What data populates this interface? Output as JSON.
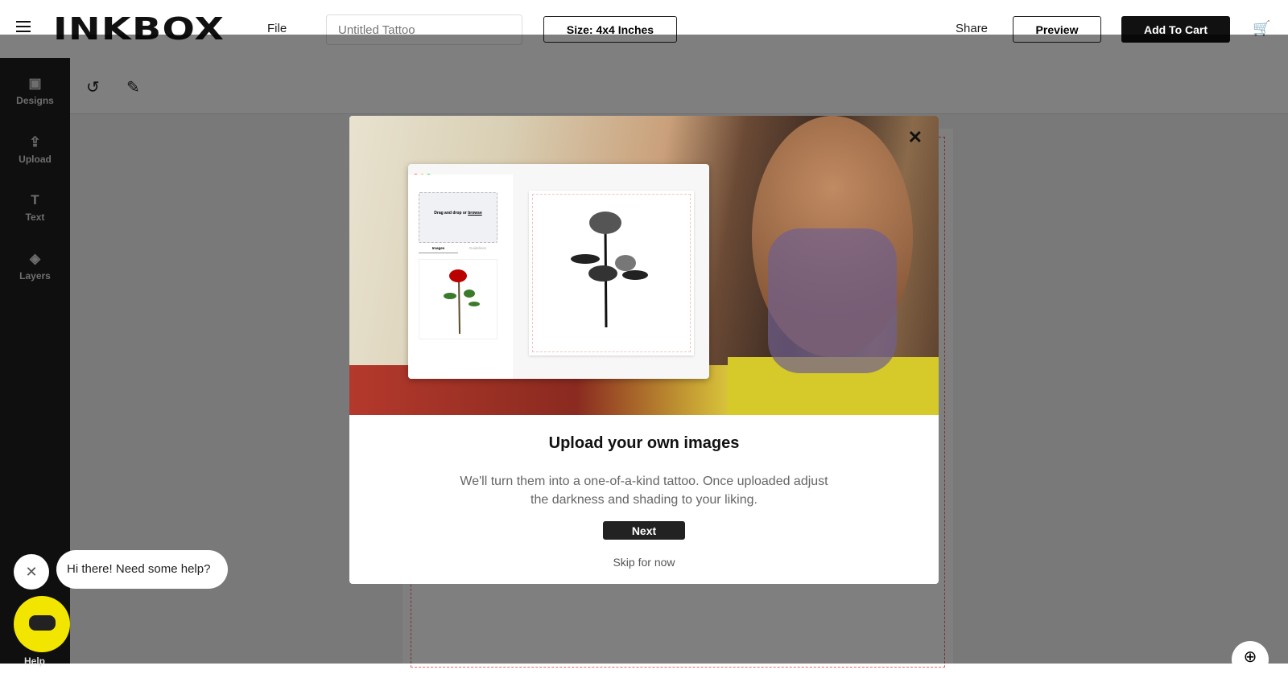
{
  "header": {
    "logo": "INKBOX",
    "file_label": "File",
    "title_placeholder": "Untitled Tattoo",
    "size_button": "Size: 4x4 Inches",
    "share_label": "Share",
    "preview_button": "Preview",
    "add_to_cart_button": "Add To Cart"
  },
  "sidebar": {
    "items": [
      {
        "label": "Designs",
        "icon": "images-icon"
      },
      {
        "label": "Upload",
        "icon": "upload-file-icon"
      },
      {
        "label": "Text",
        "icon": "text-icon"
      },
      {
        "label": "Layers",
        "icon": "layers-icon"
      }
    ]
  },
  "toolbar": {
    "icons": [
      "undo-icon",
      "pencil-icon"
    ]
  },
  "modal": {
    "title": "Upload your own images",
    "description": "We'll turn them into a one-of-a-kind tattoo. Once uploaded adjust the darkness and shading to your liking.",
    "next_button": "Next",
    "skip_link": "Skip for now",
    "mockup": {
      "drop_text": "Drag and drop or",
      "drop_link": "browse",
      "tab_images": "Images",
      "tab_guidelines": "Guidelines"
    }
  },
  "chat": {
    "bubble": "Hi there! Need some help?",
    "help_label": "Help"
  },
  "colors": {
    "help_button": "#f2e600",
    "primary": "#111111"
  }
}
